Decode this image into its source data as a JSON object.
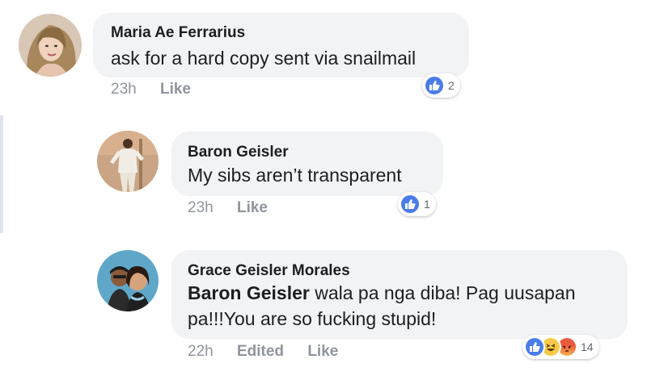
{
  "comments": [
    {
      "author": "Maria Ae Ferrarius",
      "text": "ask for a hard copy sent via snailmail",
      "time": "23h",
      "like_label": "Like",
      "reaction_count": "2",
      "reactions": [
        "like-icon"
      ]
    },
    {
      "author": "Baron Geisler",
      "text": "My sibs aren’t transparent",
      "time": "23h",
      "like_label": "Like",
      "reaction_count": "1",
      "reactions": [
        "like-icon"
      ]
    },
    {
      "author": "Grace Geisler Morales",
      "mention": "Baron Geisler",
      "text": " wala pa nga diba! Pag uusapan pa!!!You are so fucking stupid!",
      "time": "22h",
      "edited_label": "Edited",
      "like_label": "Like",
      "reaction_count": "14",
      "reactions": [
        "like-icon",
        "haha-icon",
        "angry-icon"
      ]
    }
  ],
  "colors": {
    "bubble": "#f2f3f5",
    "like_blue": "#4a7ce8",
    "meta_gray": "#90949c",
    "thread_line": "#dfe3ee"
  }
}
